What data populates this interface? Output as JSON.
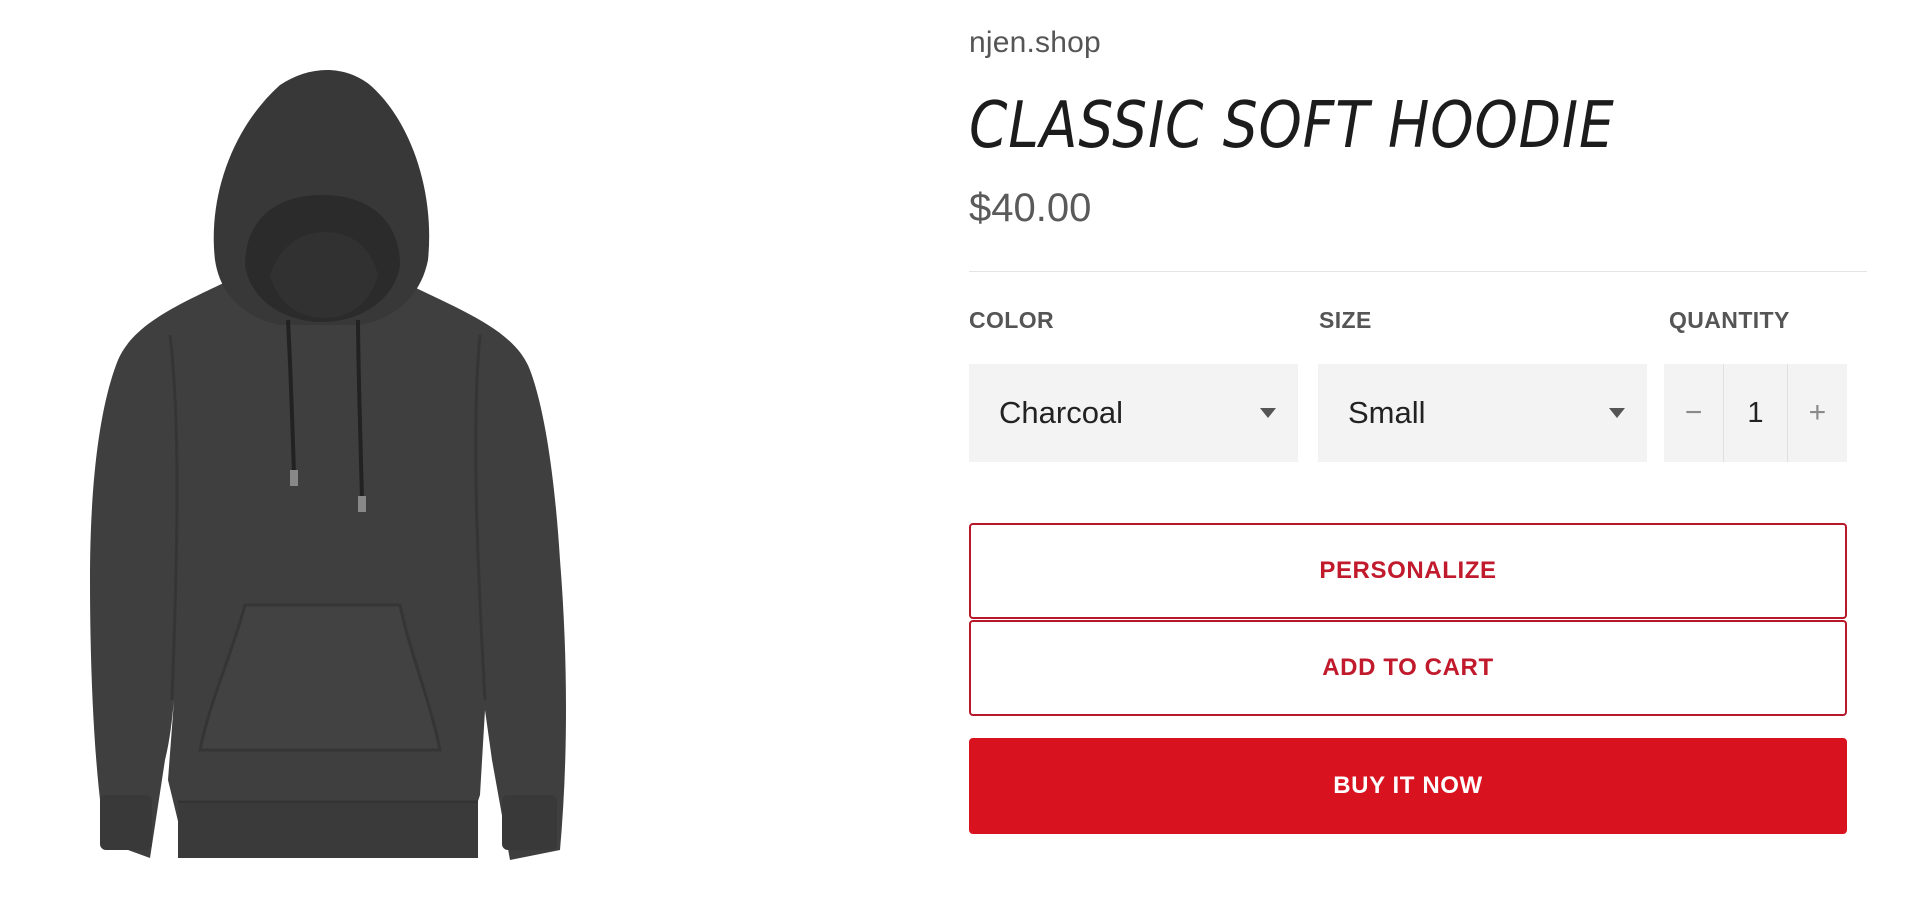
{
  "product": {
    "vendor": "njen.shop",
    "title": "CLASSIC SOFT HOODIE",
    "price": "$40.00",
    "image_alt": "Charcoal pullover hoodie"
  },
  "options": {
    "color": {
      "label": "COLOR",
      "selected": "Charcoal"
    },
    "size": {
      "label": "SIZE",
      "selected": "Small"
    },
    "quantity": {
      "label": "QUANTITY",
      "value": "1",
      "decrement": "−",
      "increment": "+"
    }
  },
  "actions": {
    "personalize": "PERSONALIZE",
    "add_to_cart": "ADD TO CART",
    "buy_now": "BUY IT NOW"
  },
  "colors": {
    "accent": "#d8121f",
    "outline": "#b6182a",
    "hoodie": "#3e3e3e"
  }
}
